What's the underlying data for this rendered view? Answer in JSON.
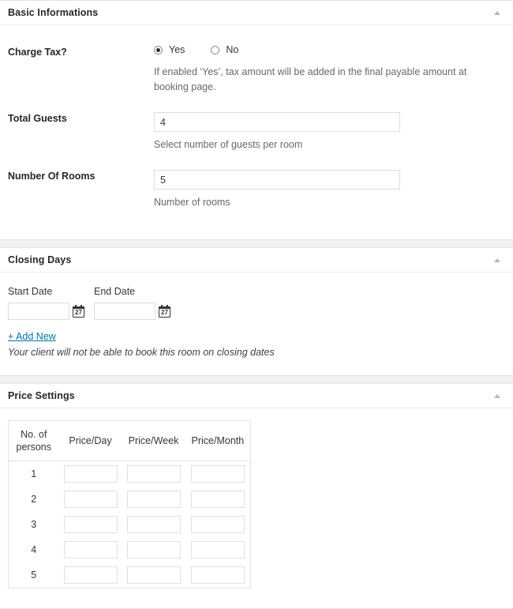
{
  "panels": {
    "basic": {
      "title": "Basic Informations",
      "toggle_icon": "chevron-up-icon",
      "charge_tax": {
        "label": "Charge Tax?",
        "options": [
          {
            "label": "Yes",
            "value": "yes",
            "selected": true
          },
          {
            "label": "No",
            "value": "no",
            "selected": false
          }
        ],
        "hint": "If enabled ‘Yes’, tax amount will be added in the final payable amount at booking page."
      },
      "total_guests": {
        "label": "Total Guests",
        "value": "4",
        "placeholder": "",
        "hint": "Select number of guests per room"
      },
      "number_of_rooms": {
        "label": "Number Of Rooms",
        "value": "5",
        "placeholder": "",
        "hint": "Number of rooms"
      }
    },
    "closing_days": {
      "title": "Closing Days",
      "toggle_icon": "chevron-up-icon",
      "start_date": {
        "label": "Start Date",
        "value": "",
        "placeholder": ""
      },
      "end_date": {
        "label": "End Date",
        "value": "",
        "placeholder": ""
      },
      "calendar_icon_day": "27",
      "add_new_label": "+ Add New",
      "note": "Your client will not be able to book this room on closing dates"
    },
    "price_settings": {
      "title": "Price Settings",
      "toggle_icon": "chevron-up-icon",
      "table": {
        "headers": [
          "No. of persons",
          "Price/Day",
          "Price/Week",
          "Price/Month"
        ],
        "rows": [
          {
            "persons": "1",
            "price_day": "",
            "price_week": "",
            "price_month": ""
          },
          {
            "persons": "2",
            "price_day": "",
            "price_week": "",
            "price_month": ""
          },
          {
            "persons": "3",
            "price_day": "",
            "price_week": "",
            "price_month": ""
          },
          {
            "persons": "4",
            "price_day": "",
            "price_week": "",
            "price_month": ""
          },
          {
            "persons": "5",
            "price_day": "",
            "price_week": "",
            "price_month": ""
          }
        ]
      }
    }
  },
  "colors": {
    "page_background": "#f1f1f1",
    "panel_background": "#ffffff",
    "border": "#e5e5e5",
    "text": "#32373c",
    "heading": "#23282d",
    "hint_text": "#646970",
    "link": "#0073aa",
    "input_border": "#dddddd",
    "arrow": "#b4b9be"
  }
}
